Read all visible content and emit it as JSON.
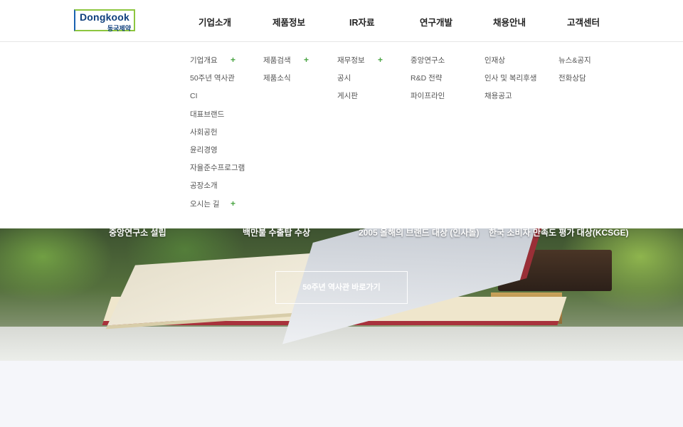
{
  "logo": {
    "en": "Dongkook",
    "ko": "동국제약"
  },
  "nav": [
    {
      "label": "기업소개",
      "items": [
        "기업개요",
        "50주년 역사관",
        "CI",
        "대표브랜드",
        "사회공헌",
        "윤리경영",
        "자율준수프로그램",
        "공장소개",
        "오시는 길"
      ],
      "plus": [
        0,
        8
      ]
    },
    {
      "label": "제품정보",
      "items": [
        "제품검색",
        "제품소식"
      ],
      "plus": [
        0
      ]
    },
    {
      "label": "IR자료",
      "items": [
        "재무정보",
        "공시",
        "게시판"
      ],
      "plus": [
        0
      ]
    },
    {
      "label": "연구개발",
      "items": [
        "중앙연구소",
        "R&D 전략",
        "파이프라인"
      ],
      "plus": []
    },
    {
      "label": "채용안내",
      "items": [
        "인재상",
        "인사 및 복리후생",
        "채용공고"
      ],
      "plus": []
    },
    {
      "label": "고객센터",
      "items": [
        "뉴스&공지",
        "전화상담"
      ],
      "plus": []
    }
  ],
  "plus_symbol": "+",
  "hero": {
    "timeline": [
      "중앙연구소 설립",
      "백만불 수출탑 수상",
      "2005 올해의 브랜드 대상 (인사돌)",
      "한국 소비자 만족도 평가 대상(KCSGE)"
    ],
    "button_label": "50주년 역사관 바로가기"
  },
  "colors": {
    "accent_green": "#4ba544",
    "logo_blue": "#0f3f7d",
    "logo_green": "#8dc63f"
  }
}
